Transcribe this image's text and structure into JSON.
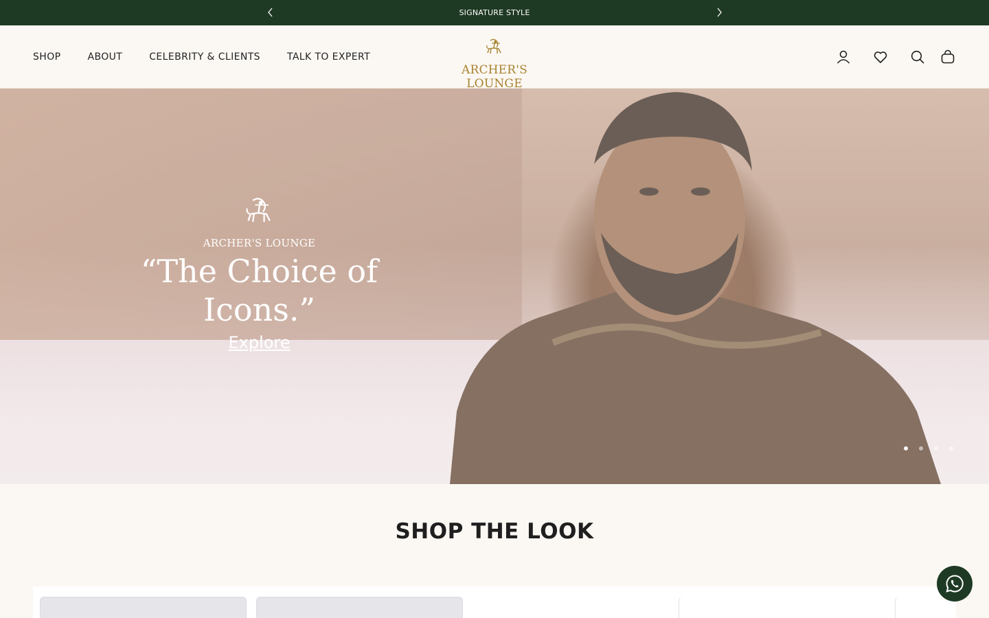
{
  "announcement": {
    "text": "SIGNATURE STYLE",
    "prev_icon": "chevron-left-icon",
    "next_icon": "chevron-right-icon"
  },
  "nav": {
    "items": [
      {
        "label": "SHOP"
      },
      {
        "label": "ABOUT"
      },
      {
        "label": "CELEBRITY & CLIENTS"
      },
      {
        "label": "TALK TO EXPERT"
      }
    ]
  },
  "logo": {
    "text": "ARCHER'S LOUNGE",
    "icon": "archer-logo-icon"
  },
  "header_icons": [
    "account-icon",
    "wishlist-heart-icon",
    "search-icon",
    "cart-bag-icon"
  ],
  "hero": {
    "brand": "ARCHER'S LOUNGE",
    "tagline": "“The Choice of Icons.”",
    "cta": "Explore",
    "slides": 4,
    "active_slide": 1
  },
  "section": {
    "title": "SHOP THE LOOK"
  },
  "whatsapp": {
    "icon": "whatsapp-icon"
  },
  "colors": {
    "brand_green": "#1f3a24",
    "gold": "#a8822e",
    "background": "#fbf8f3"
  }
}
